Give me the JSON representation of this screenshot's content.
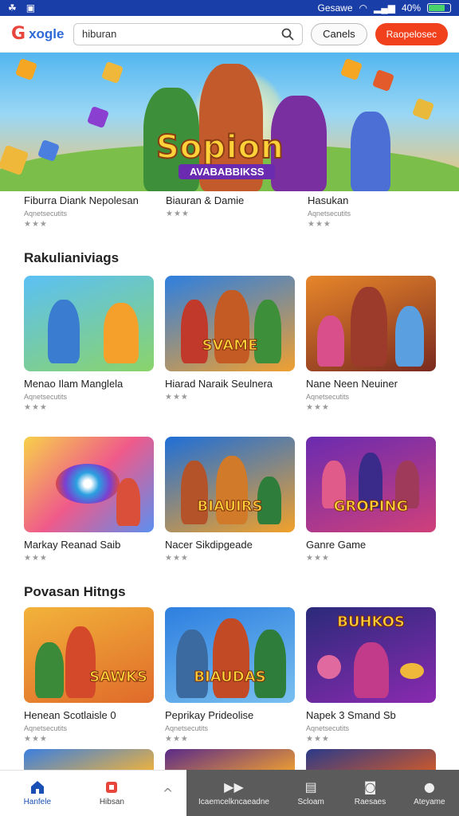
{
  "status": {
    "left_icons": [
      "android-icon",
      "notification-icon"
    ],
    "right_text": "Gesawe",
    "battery_percent": "40%"
  },
  "header": {
    "logo_text": "xogle",
    "search_value": "hiburan",
    "cancel_label": "Canels",
    "primary_label": "Raopelosec"
  },
  "hero": {
    "title": "Sopion",
    "subtitle": "AVABABBIKSS"
  },
  "row1": [
    {
      "name": "Fiburra Diank Nepolesan",
      "sub": "Aqnetsecutits",
      "stars": "★★★"
    },
    {
      "name": "Biauran & Damie",
      "sub": "",
      "stars": "★★★"
    },
    {
      "name": "Hasukan",
      "sub": "Aqnetsecutits",
      "stars": "★★★"
    }
  ],
  "section1": {
    "title": "Rakulianiviags",
    "apps": [
      {
        "name": "Menao Ilam Manglela",
        "sub": "Aqnetsecutits",
        "stars": "★★★"
      },
      {
        "name": "Hiarad Naraik Seulnera",
        "sub": "",
        "stars": "★★★"
      },
      {
        "name": "Nane Neen Neuiner",
        "sub": "Aqnetsecutits",
        "stars": "★★★"
      }
    ],
    "apps2": [
      {
        "name": "Markay Reanad Saib",
        "sub": "",
        "stars": "★★★"
      },
      {
        "name": "Nacer Sikdipgeade",
        "sub": "",
        "stars": "★★★"
      },
      {
        "name": "Ganre Game",
        "sub": "",
        "stars": "★★★"
      }
    ],
    "banners": [
      "SVAME",
      "",
      "",
      "",
      "BIAUIRS",
      "GROPING"
    ]
  },
  "section2": {
    "title": "Povasan Hitngs",
    "apps": [
      {
        "name": "Henean Scotlaisle  0",
        "sub": "Aqnetsecutits",
        "stars": "★★★"
      },
      {
        "name": "Peprikay Prideolise",
        "sub": "Aqnetsecutits",
        "stars": "★★★"
      },
      {
        "name": "Napek 3 Smand Sb",
        "sub": "Aqnetsecutits",
        "stars": "★★★"
      }
    ],
    "banners": [
      "SAWKS",
      "BIAUDAS",
      "BUHKOS"
    ]
  },
  "nav": [
    {
      "label": "Hanfele",
      "icon": "home-icon"
    },
    {
      "label": "Hibsan",
      "icon": "apps-icon"
    },
    {
      "label": "Icaemcelkncaeadne",
      "icon": "movies-icon"
    },
    {
      "label": "Scloam",
      "icon": "books-icon"
    },
    {
      "label": "Raesaes",
      "icon": "profile-icon"
    },
    {
      "label": "Ateyame",
      "icon": "settings-icon"
    }
  ],
  "colors": {
    "accent": "#f0401c",
    "brand": "#1a3ea8",
    "nav_active": "#1a4fb5"
  }
}
